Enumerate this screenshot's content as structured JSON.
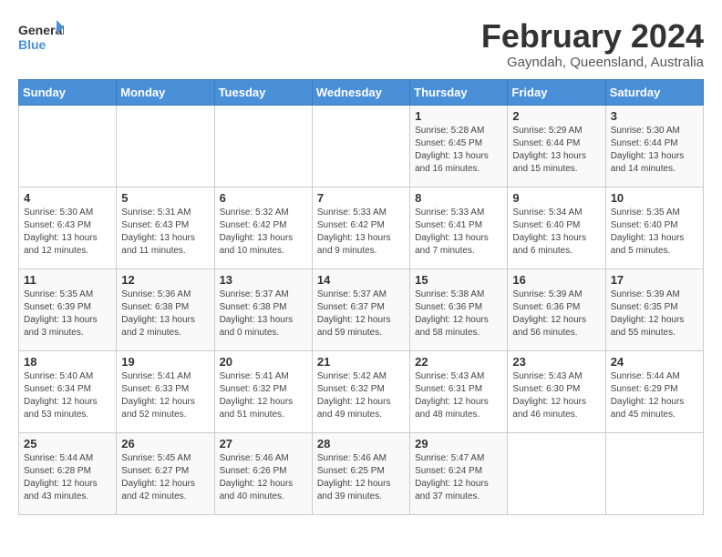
{
  "logo": {
    "line1": "General",
    "line2": "Blue"
  },
  "title": "February 2024",
  "subtitle": "Gayndah, Queensland, Australia",
  "days_of_week": [
    "Sunday",
    "Monday",
    "Tuesday",
    "Wednesday",
    "Thursday",
    "Friday",
    "Saturday"
  ],
  "weeks": [
    [
      {
        "day": "",
        "info": ""
      },
      {
        "day": "",
        "info": ""
      },
      {
        "day": "",
        "info": ""
      },
      {
        "day": "",
        "info": ""
      },
      {
        "day": "1",
        "info": "Sunrise: 5:28 AM\nSunset: 6:45 PM\nDaylight: 13 hours\nand 16 minutes."
      },
      {
        "day": "2",
        "info": "Sunrise: 5:29 AM\nSunset: 6:44 PM\nDaylight: 13 hours\nand 15 minutes."
      },
      {
        "day": "3",
        "info": "Sunrise: 5:30 AM\nSunset: 6:44 PM\nDaylight: 13 hours\nand 14 minutes."
      }
    ],
    [
      {
        "day": "4",
        "info": "Sunrise: 5:30 AM\nSunset: 6:43 PM\nDaylight: 13 hours\nand 12 minutes."
      },
      {
        "day": "5",
        "info": "Sunrise: 5:31 AM\nSunset: 6:43 PM\nDaylight: 13 hours\nand 11 minutes."
      },
      {
        "day": "6",
        "info": "Sunrise: 5:32 AM\nSunset: 6:42 PM\nDaylight: 13 hours\nand 10 minutes."
      },
      {
        "day": "7",
        "info": "Sunrise: 5:33 AM\nSunset: 6:42 PM\nDaylight: 13 hours\nand 9 minutes."
      },
      {
        "day": "8",
        "info": "Sunrise: 5:33 AM\nSunset: 6:41 PM\nDaylight: 13 hours\nand 7 minutes."
      },
      {
        "day": "9",
        "info": "Sunrise: 5:34 AM\nSunset: 6:40 PM\nDaylight: 13 hours\nand 6 minutes."
      },
      {
        "day": "10",
        "info": "Sunrise: 5:35 AM\nSunset: 6:40 PM\nDaylight: 13 hours\nand 5 minutes."
      }
    ],
    [
      {
        "day": "11",
        "info": "Sunrise: 5:35 AM\nSunset: 6:39 PM\nDaylight: 13 hours\nand 3 minutes."
      },
      {
        "day": "12",
        "info": "Sunrise: 5:36 AM\nSunset: 6:38 PM\nDaylight: 13 hours\nand 2 minutes."
      },
      {
        "day": "13",
        "info": "Sunrise: 5:37 AM\nSunset: 6:38 PM\nDaylight: 13 hours\nand 0 minutes."
      },
      {
        "day": "14",
        "info": "Sunrise: 5:37 AM\nSunset: 6:37 PM\nDaylight: 12 hours\nand 59 minutes."
      },
      {
        "day": "15",
        "info": "Sunrise: 5:38 AM\nSunset: 6:36 PM\nDaylight: 12 hours\nand 58 minutes."
      },
      {
        "day": "16",
        "info": "Sunrise: 5:39 AM\nSunset: 6:36 PM\nDaylight: 12 hours\nand 56 minutes."
      },
      {
        "day": "17",
        "info": "Sunrise: 5:39 AM\nSunset: 6:35 PM\nDaylight: 12 hours\nand 55 minutes."
      }
    ],
    [
      {
        "day": "18",
        "info": "Sunrise: 5:40 AM\nSunset: 6:34 PM\nDaylight: 12 hours\nand 53 minutes."
      },
      {
        "day": "19",
        "info": "Sunrise: 5:41 AM\nSunset: 6:33 PM\nDaylight: 12 hours\nand 52 minutes."
      },
      {
        "day": "20",
        "info": "Sunrise: 5:41 AM\nSunset: 6:32 PM\nDaylight: 12 hours\nand 51 minutes."
      },
      {
        "day": "21",
        "info": "Sunrise: 5:42 AM\nSunset: 6:32 PM\nDaylight: 12 hours\nand 49 minutes."
      },
      {
        "day": "22",
        "info": "Sunrise: 5:43 AM\nSunset: 6:31 PM\nDaylight: 12 hours\nand 48 minutes."
      },
      {
        "day": "23",
        "info": "Sunrise: 5:43 AM\nSunset: 6:30 PM\nDaylight: 12 hours\nand 46 minutes."
      },
      {
        "day": "24",
        "info": "Sunrise: 5:44 AM\nSunset: 6:29 PM\nDaylight: 12 hours\nand 45 minutes."
      }
    ],
    [
      {
        "day": "25",
        "info": "Sunrise: 5:44 AM\nSunset: 6:28 PM\nDaylight: 12 hours\nand 43 minutes."
      },
      {
        "day": "26",
        "info": "Sunrise: 5:45 AM\nSunset: 6:27 PM\nDaylight: 12 hours\nand 42 minutes."
      },
      {
        "day": "27",
        "info": "Sunrise: 5:46 AM\nSunset: 6:26 PM\nDaylight: 12 hours\nand 40 minutes."
      },
      {
        "day": "28",
        "info": "Sunrise: 5:46 AM\nSunset: 6:25 PM\nDaylight: 12 hours\nand 39 minutes."
      },
      {
        "day": "29",
        "info": "Sunrise: 5:47 AM\nSunset: 6:24 PM\nDaylight: 12 hours\nand 37 minutes."
      },
      {
        "day": "",
        "info": ""
      },
      {
        "day": "",
        "info": ""
      }
    ]
  ]
}
